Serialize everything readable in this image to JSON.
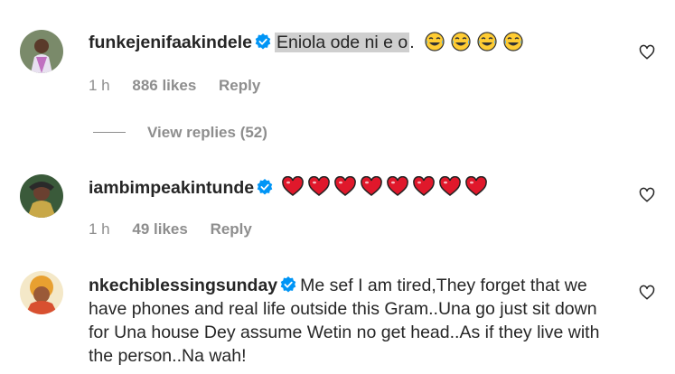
{
  "comments": [
    {
      "username": "funkejenifaakindele",
      "highlighted_text": "Eniola ode ni e o",
      "text_suffix": ".",
      "emoji_name": "face-with-tears-of-joy-icon",
      "emoji_count": 4,
      "time": "1 h",
      "likes": "886 likes",
      "reply_label": "Reply",
      "view_replies": "View replies (52)"
    },
    {
      "username": "iambimpeakintunde",
      "emoji_name": "red-heart-icon",
      "emoji_count": 8,
      "time": "1 h",
      "likes": "49 likes",
      "reply_label": "Reply"
    },
    {
      "username": "nkechiblessingsunday",
      "text": "Me sef I am tired,They forget that we have phones and real life outside this Gram..Una go just sit down for Una house Dey assume Wetin no get head..As if they live with the person..Na wah!"
    }
  ],
  "colors": {
    "text": "#262626",
    "meta": "#8e8e8e",
    "verified": "#0095f6",
    "heart": "#e0182b"
  }
}
